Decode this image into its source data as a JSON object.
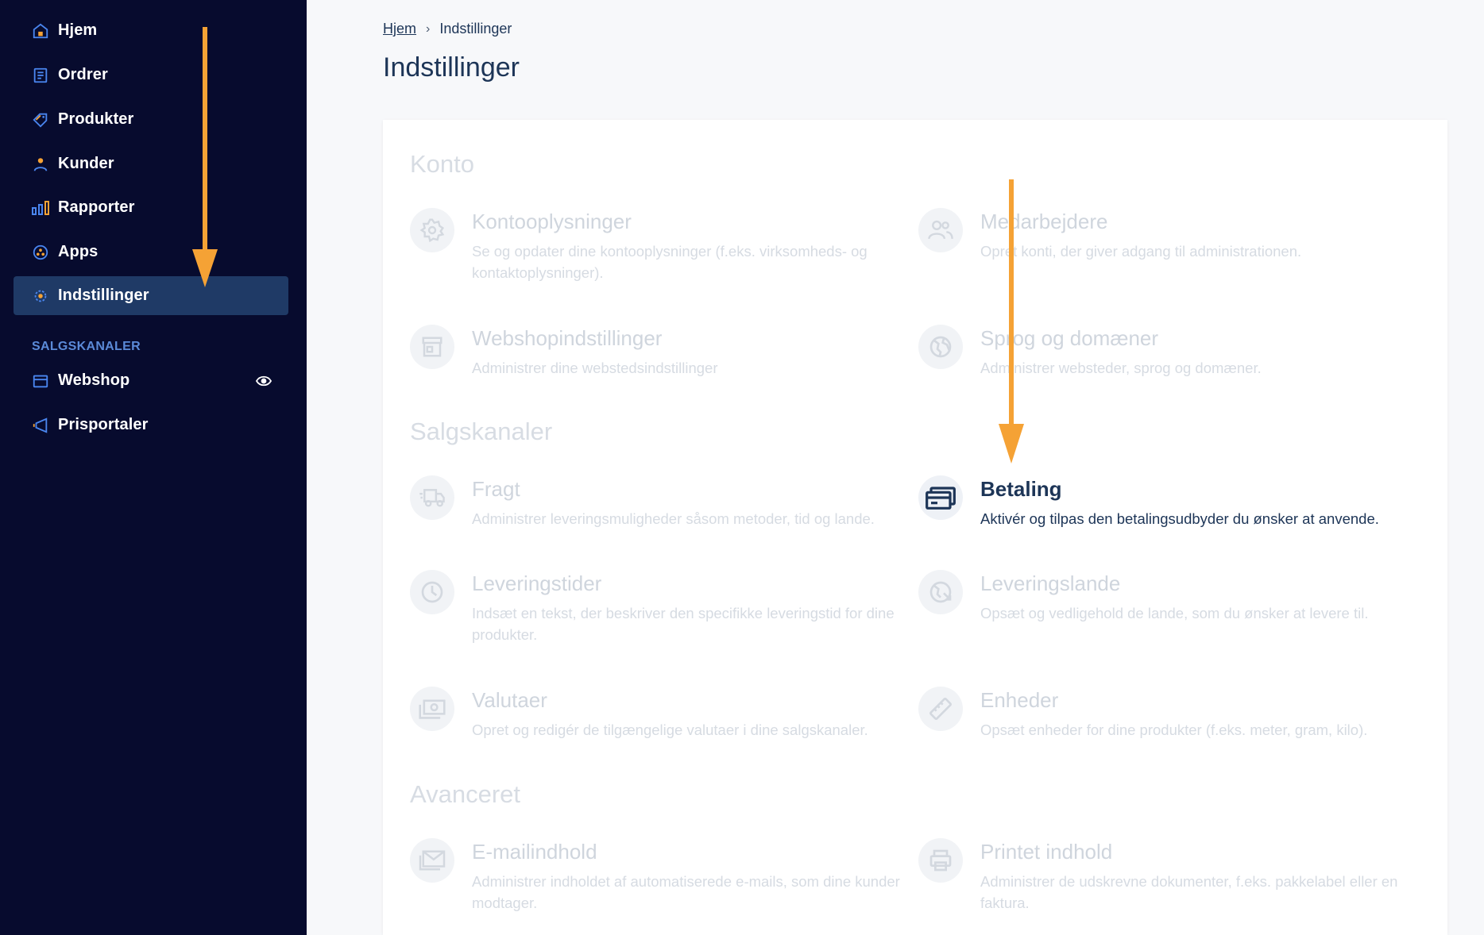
{
  "sidebar": {
    "items": [
      {
        "label": "Hjem",
        "icon": "home-icon"
      },
      {
        "label": "Ordrer",
        "icon": "orders-icon"
      },
      {
        "label": "Produkter",
        "icon": "tag-icon"
      },
      {
        "label": "Kunder",
        "icon": "user-icon"
      },
      {
        "label": "Rapporter",
        "icon": "bar-chart-icon"
      },
      {
        "label": "Apps",
        "icon": "apps-icon"
      },
      {
        "label": "Indstillinger",
        "icon": "gear-icon",
        "active": true
      }
    ],
    "section_label": "SALGSKANALER",
    "channels": [
      {
        "label": "Webshop",
        "icon": "store-icon",
        "trailing_icon": "eye-icon"
      },
      {
        "label": "Prisportaler",
        "icon": "megaphone-icon"
      }
    ]
  },
  "breadcrumb": {
    "home": "Hjem",
    "current": "Indstillinger"
  },
  "page_title": "Indstillinger",
  "groups": {
    "konto": "Konto",
    "salgskanaler": "Salgskanaler",
    "avanceret": "Avanceret"
  },
  "cards": {
    "kontooplysninger": {
      "title": "Kontooplysninger",
      "desc": "Se og opdater dine kontooplysninger (f.eks. virksomheds- og kontaktoplysninger).",
      "icon": "gear-icon"
    },
    "medarbejdere": {
      "title": "Medarbejdere",
      "desc": "Opret konti, der giver adgang til administrationen.",
      "icon": "users-icon"
    },
    "webshopindstillinger": {
      "title": "Webshopindstillinger",
      "desc": "Administrer dine webstedsindstillinger",
      "icon": "store-icon"
    },
    "sprog": {
      "title": "Sprog og domæner",
      "desc": "Administrer websteder, sprog og domæner.",
      "icon": "globe-icon"
    },
    "fragt": {
      "title": "Fragt",
      "desc": "Administrer leveringsmuligheder såsom metoder, tid og lande.",
      "icon": "truck-icon"
    },
    "betaling": {
      "title": "Betaling",
      "desc": "Aktivér og tilpas den betalingsudbyder du ønsker at anvende.",
      "icon": "credit-card-icon"
    },
    "leveringstider": {
      "title": "Leveringstider",
      "desc": "Indsæt en tekst, der beskriver den specifikke leveringstid for dine produkter.",
      "icon": "clock-icon"
    },
    "leveringslande": {
      "title": "Leveringslande",
      "desc": "Opsæt og vedligehold de lande, som du ønsker at levere til.",
      "icon": "globe-arrow-icon"
    },
    "valutaer": {
      "title": "Valutaer",
      "desc": "Opret og redigér de tilgængelige valutaer i dine salgskanaler.",
      "icon": "money-icon"
    },
    "enheder": {
      "title": "Enheder",
      "desc": "Opsæt enheder for dine produkter (f.eks. meter, gram, kilo).",
      "icon": "ruler-icon"
    },
    "emailindhold": {
      "title": "E-mailindhold",
      "desc": "Administrer indholdet af automatiserede e-mails, som dine kunder modtager.",
      "icon": "mail-icon"
    },
    "printet": {
      "title": "Printet indhold",
      "desc": "Administrer de udskrevne dokumenter, f.eks. pakkelabel eller en faktura.",
      "icon": "printer-icon"
    }
  },
  "colors": {
    "sidebar_bg": "#070b2e",
    "active_bg": "#1f3a66",
    "accent_orange": "#f5a235",
    "text_dark": "#1d3557"
  }
}
